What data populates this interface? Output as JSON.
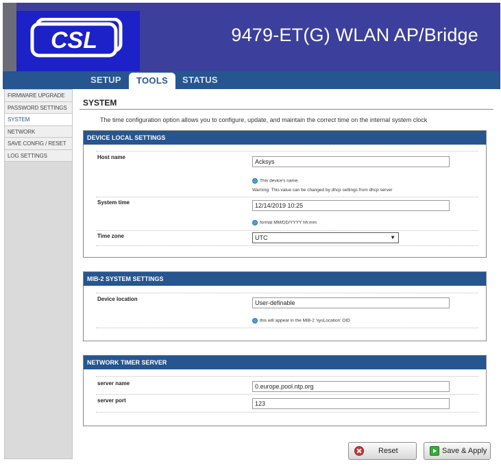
{
  "header": {
    "logo_text": "CSL",
    "product_title": "9479-ET(G) WLAN AP/Bridge"
  },
  "nav": {
    "tabs": [
      {
        "label": "SETUP"
      },
      {
        "label": "TOOLS"
      },
      {
        "label": "STATUS"
      }
    ],
    "active_tab": "TOOLS"
  },
  "sidebar": {
    "items": [
      {
        "label": "FIRMWARE UPGRADE"
      },
      {
        "label": "PASSWORD SETTINGS"
      },
      {
        "label": "SYSTEM"
      },
      {
        "label": "NETWORK"
      },
      {
        "label": "SAVE CONFIG / RESET"
      },
      {
        "label": "LOG SETTINGS"
      }
    ],
    "active_item": "SYSTEM"
  },
  "page": {
    "title": "SYSTEM",
    "description": "The time configuration option allows you to configure, update, and maintain the correct time on the internal system clock"
  },
  "device_local": {
    "heading": "DEVICE LOCAL SETTINGS",
    "host_name_label": "Host name",
    "host_name_value": "Acksys",
    "host_name_hint": "This device's name.",
    "host_name_warning": "Warning: This value can be changed by dhcp settings from dhcp server",
    "system_time_label": "System time",
    "system_time_value": "12/14/2019 10:25",
    "system_time_hint": "format MM/DD/YYYY hh:mm",
    "time_zone_label": "Time zone",
    "time_zone_value": "UTC"
  },
  "mib2": {
    "heading": "MIB-2 SYSTEM SETTINGS",
    "device_location_label": "Device location",
    "device_location_value": "User-definable",
    "device_location_hint": "this will appear in the MIB-2 'sysLocation' OID"
  },
  "ntp": {
    "heading": "NETWORK TIMER SERVER",
    "server_name_label": "server name",
    "server_name_value": "0.europe.pool.ntp.org",
    "server_port_label": "server port",
    "server_port_value": "123"
  },
  "buttons": {
    "reset_label": "Reset",
    "save_label": "Save & Apply"
  },
  "colors": {
    "header_bg": "#3c3f9c",
    "logo_bg": "#1c21c8",
    "nav_bg": "#26558f",
    "panel_head": "#26558f"
  }
}
